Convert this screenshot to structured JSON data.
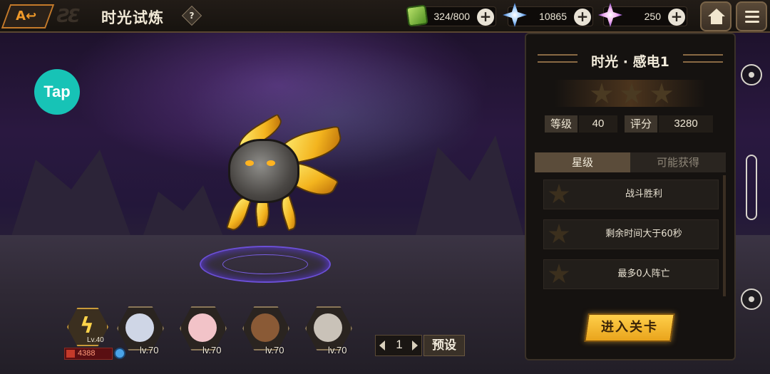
{
  "header": {
    "title": "时光试炼",
    "help": "?",
    "resources": [
      {
        "name": "stamina",
        "icon": "green-cube-icon",
        "value": "324/800"
      },
      {
        "name": "diamond",
        "icon": "blue-crystal-icon",
        "value": "10865"
      },
      {
        "name": "star-crystal",
        "icon": "pink-crystal-icon",
        "value": "250"
      }
    ]
  },
  "side": {
    "tap_logo": "Tap"
  },
  "stage": {
    "title": "时光 · 感电1",
    "stars_earned": 0,
    "stars_total": 3,
    "level_label": "等级",
    "level_value": "40",
    "score_label": "评分",
    "score_value": "3280"
  },
  "tabs": [
    {
      "label": "星级",
      "active": true
    },
    {
      "label": "可能获得",
      "active": false
    }
  ],
  "conditions": [
    {
      "text": "战斗胜利"
    },
    {
      "text": "剩余时间大于60秒"
    },
    {
      "text": "最多0人阵亡"
    }
  ],
  "enter_button": "进入关卡",
  "team": {
    "leader_level": "Lv.40",
    "power": "4388",
    "heroes": [
      {
        "level": "lv.70",
        "color": "#cfd6e6"
      },
      {
        "level": "lv.70",
        "color": "#f2c3c8"
      },
      {
        "level": "lv.70",
        "color": "#8a5a36"
      },
      {
        "level": "lv.70",
        "color": "#c9c2b8"
      }
    ],
    "page": "1",
    "preset_label": "预设"
  },
  "colors": {
    "accent": "#f0a82a",
    "panel": "#151210",
    "tap": "#17c3b6"
  }
}
